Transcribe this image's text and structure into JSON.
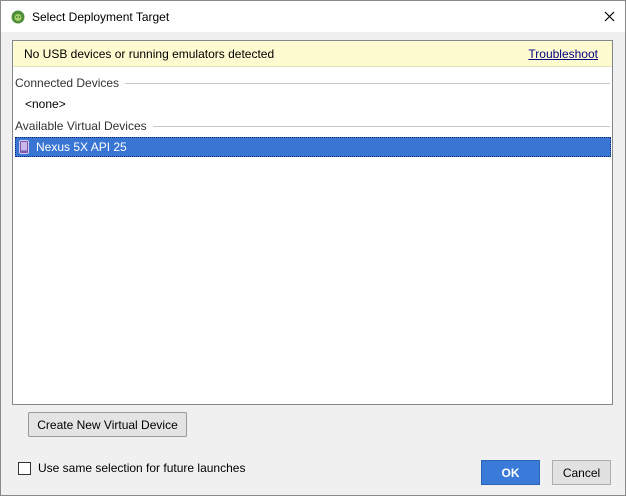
{
  "window": {
    "title": "Select Deployment Target",
    "app_icon": "android-studio-icon",
    "close_icon": "close-icon"
  },
  "banner": {
    "message": "No USB devices or running emulators detected",
    "link": "Troubleshoot"
  },
  "connected": {
    "header": "Connected Devices",
    "items": [
      "<none>"
    ]
  },
  "available": {
    "header": "Available Virtual Devices",
    "items": [
      {
        "label": "Nexus 5X API 25",
        "icon": "phone-icon",
        "selected": true
      }
    ]
  },
  "buttons": {
    "create": "Create New Virtual Device",
    "ok": "OK",
    "cancel": "Cancel"
  },
  "checkbox": {
    "label": "Use same selection for future launches",
    "checked": false
  },
  "colors": {
    "banner_bg": "#fffbd0",
    "selection": "#3976d4",
    "ok_button": "#3a7ad8"
  }
}
